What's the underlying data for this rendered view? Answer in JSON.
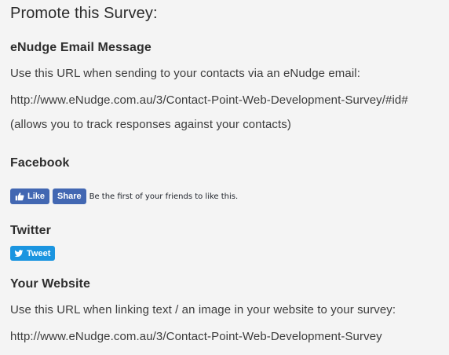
{
  "page": {
    "title": "Promote this Survey:"
  },
  "enudge": {
    "heading": "eNudge Email Message",
    "instruction": "Use this URL when sending to your contacts via an eNudge email:",
    "url": "http://www.eNudge.com.au/3/Contact-Point-Web-Development-Survey/#id#",
    "note": "(allows you to track responses against your contacts)"
  },
  "facebook": {
    "heading": "Facebook",
    "like_label": "Like",
    "share_label": "Share",
    "social_text": "Be the first of your friends to like this.",
    "brand_color": "#4267b2",
    "icons": {
      "like": "thumbs-up-icon"
    }
  },
  "twitter": {
    "heading": "Twitter",
    "tweet_label": "Tweet",
    "brand_color": "#1b95e0",
    "icons": {
      "tweet": "twitter-bird-icon"
    }
  },
  "website": {
    "heading": "Your Website",
    "instruction": "Use this URL when linking text / an image in your website to your survey:",
    "url": "http://www.eNudge.com.au/3/Contact-Point-Web-Development-Survey"
  },
  "colors": {
    "background": "#f4f4f4",
    "text": "#3c3c3c"
  }
}
